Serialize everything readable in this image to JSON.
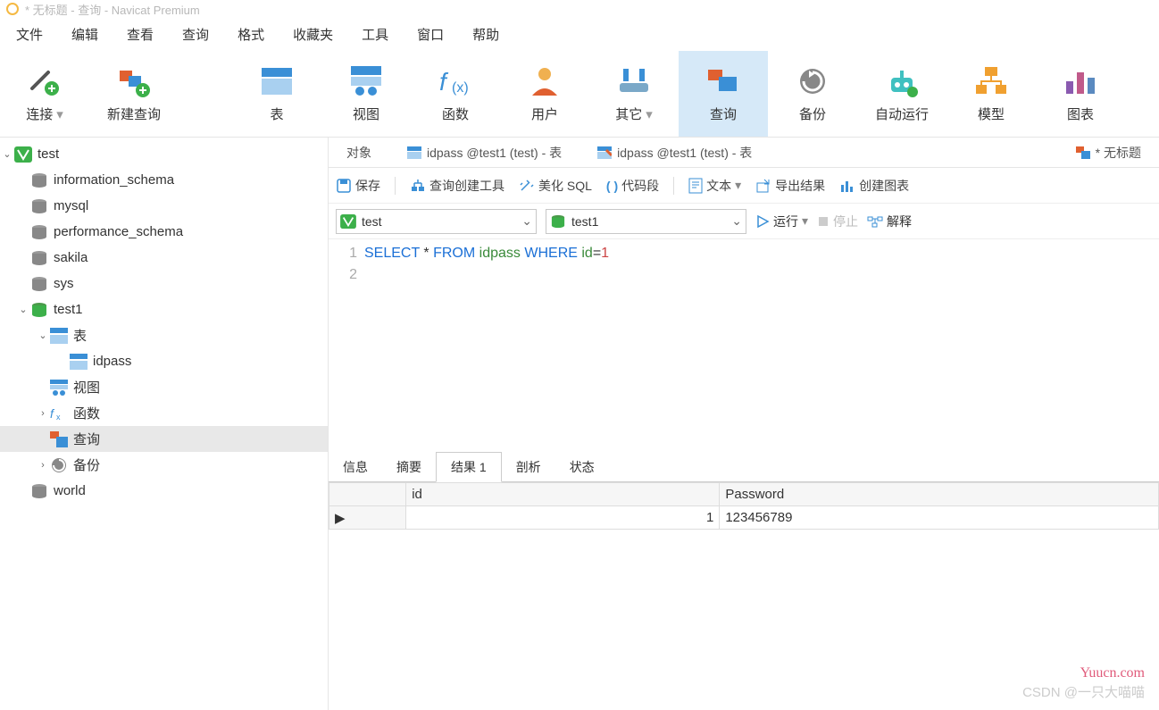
{
  "title": "* 无标题 - 查询 - Navicat Premium",
  "menu": [
    "文件",
    "编辑",
    "查看",
    "查询",
    "格式",
    "收藏夹",
    "工具",
    "窗口",
    "帮助"
  ],
  "toolbar": [
    {
      "label": "连接",
      "icon": "plug"
    },
    {
      "label": "新建查询",
      "icon": "new-query"
    },
    {
      "label": "表",
      "icon": "table"
    },
    {
      "label": "视图",
      "icon": "view"
    },
    {
      "label": "函数",
      "icon": "fx"
    },
    {
      "label": "用户",
      "icon": "user"
    },
    {
      "label": "其它",
      "icon": "other"
    },
    {
      "label": "查询",
      "icon": "query",
      "active": true
    },
    {
      "label": "备份",
      "icon": "backup"
    },
    {
      "label": "自动运行",
      "icon": "auto"
    },
    {
      "label": "模型",
      "icon": "model"
    },
    {
      "label": "图表",
      "icon": "chart"
    }
  ],
  "tree": {
    "root": "test",
    "dbs": [
      "information_schema",
      "mysql",
      "performance_schema",
      "sakila",
      "sys"
    ],
    "active_db": "test1",
    "nodes": {
      "tables": "表",
      "table_item": "idpass",
      "views": "视图",
      "funcs": "函数",
      "queries": "查询",
      "backups": "备份"
    },
    "extra_db": "world"
  },
  "file_tabs": {
    "t1": "对象",
    "t2": "idpass @test1 (test) - 表",
    "t3": "idpass @test1 (test) - 表",
    "t4": "* 无标题"
  },
  "tool_row": {
    "save": "保存",
    "builder": "查询创建工具",
    "beautify": "美化 SQL",
    "snippet": "代码段",
    "text": "文本",
    "export": "导出结果",
    "chart": "创建图表"
  },
  "sel_row": {
    "conn": "test",
    "db": "test1",
    "run": "运行",
    "stop": "停止",
    "explain": "解释"
  },
  "sql": {
    "l1": "1",
    "l2": "2",
    "kw1": "SELECT",
    "star": "*",
    "kw2": "FROM",
    "tbl": "idpass",
    "kw3": "WHERE",
    "col": "id",
    "eq": "=",
    "val": "1"
  },
  "result_tabs": [
    "信息",
    "摘要",
    "结果 1",
    "剖析",
    "状态"
  ],
  "grid": {
    "h1": "id",
    "h2": "Password",
    "r1c1": "1",
    "r1c2": "123456789"
  },
  "watermark": "Yuucn.com",
  "watermark2": "CSDN @一只大喵喵"
}
